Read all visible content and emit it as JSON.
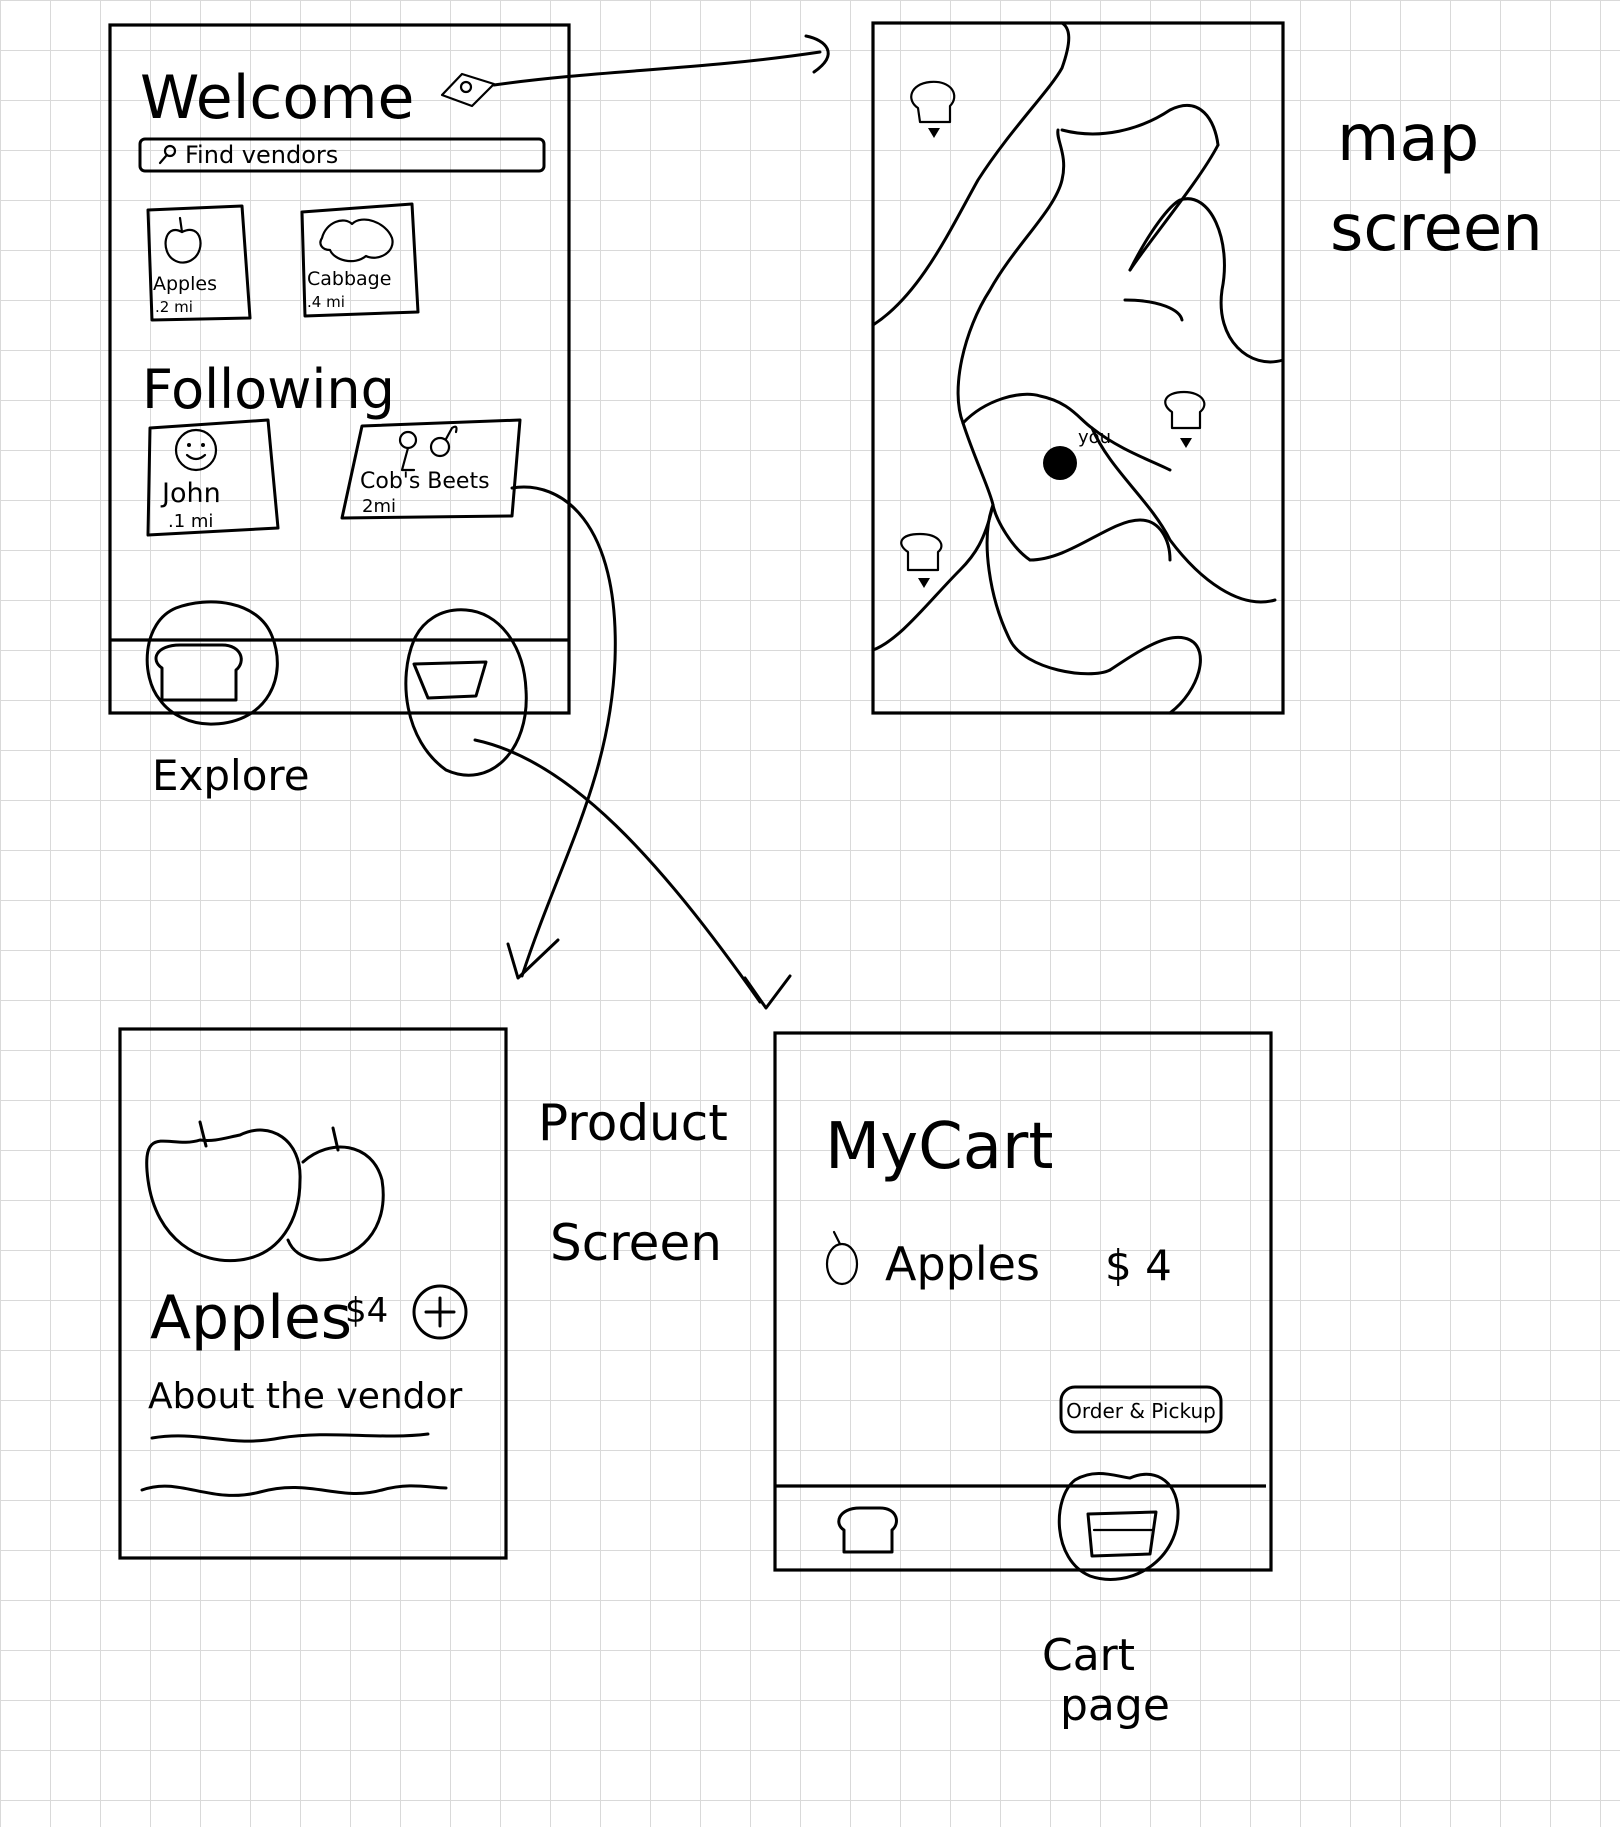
{
  "home_screen": {
    "title": "Welcome",
    "search": {
      "placeholder": "Find vendors"
    },
    "nearby": [
      {
        "name": "Apples",
        "distance": ".2 mi"
      },
      {
        "name": "Cabbage",
        "distance": ".4 mi"
      }
    ],
    "following_heading": "Following",
    "following": [
      {
        "name": "John",
        "distance": ".1 mi"
      },
      {
        "name": "Cob's Beets",
        "distance": "2mi"
      }
    ],
    "nav": {
      "explore_caption": "Explore"
    }
  },
  "map_screen": {
    "caption_line1": "map",
    "caption_line2": "screen",
    "you_label": "you"
  },
  "product_screen": {
    "caption_line1": "Product",
    "caption_line2": "Screen",
    "name": "Apples",
    "price": "$4",
    "about_label": "About the vendor"
  },
  "cart_screen": {
    "title": "MyCart",
    "item_name": "Apples",
    "item_price": "$ 4",
    "order_button": "Order & Pickup",
    "caption_line1": "Cart",
    "caption_line2": "page"
  }
}
